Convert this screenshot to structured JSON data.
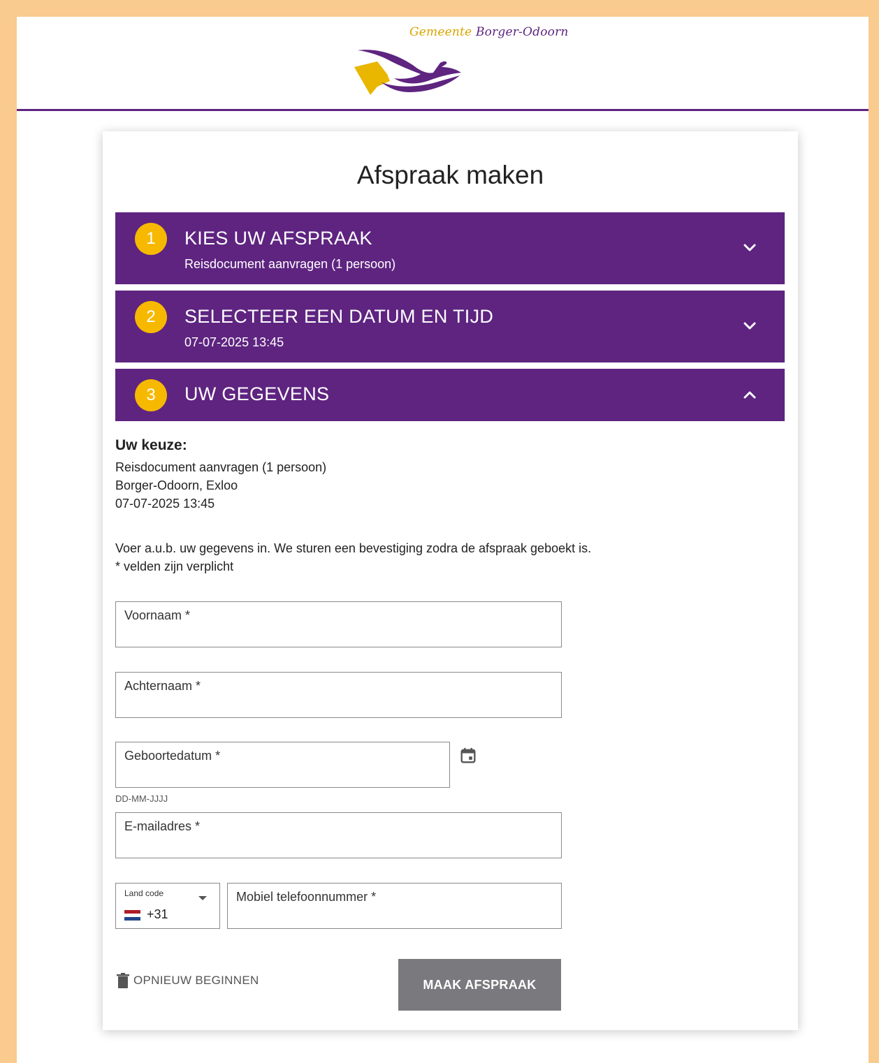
{
  "header": {
    "brand_word1": "Gemeente",
    "brand_word2": "Borger-Odoorn"
  },
  "page": {
    "title": "Afspraak maken"
  },
  "steps": [
    {
      "number": "1",
      "title": "KIES UW AFSPRAAK",
      "subtitle": "Reisdocument aanvragen (1 persoon)",
      "state": "collapsed",
      "icon": "chevron-down-icon"
    },
    {
      "number": "2",
      "title": "SELECTEER EEN DATUM EN TIJD",
      "subtitle": "07-07-2025 13:45",
      "state": "collapsed",
      "icon": "chevron-down-icon"
    },
    {
      "number": "3",
      "title": "UW GEGEVENS",
      "subtitle": "",
      "state": "expanded",
      "icon": "chevron-up-icon"
    }
  ],
  "choice": {
    "heading": "Uw keuze:",
    "lines": [
      "Reisdocument aanvragen (1 persoon)",
      "Borger-Odoorn, Exloo",
      "07-07-2025 13:45"
    ]
  },
  "instructions": {
    "line1": "Voer a.u.b. uw gegevens in. We sturen een bevestiging zodra de afspraak geboekt is.",
    "line2": "* velden zijn verplicht"
  },
  "form": {
    "first_name_label": "Voornaam *",
    "last_name_label": "Achternaam *",
    "birthdate_label": "Geboortedatum *",
    "birthdate_hint": "DD-MM-JJJJ",
    "email_label": "E-mailadres *",
    "country_code_label": "Land code",
    "country_code_value": "+31",
    "phone_label": "Mobiel telefoonnummer *"
  },
  "actions": {
    "reset_label": "OPNIEUW BEGINNEN",
    "submit_label": "MAAK AFSPRAAK"
  },
  "colors": {
    "purple": "#5e2480",
    "gold": "#f6b900",
    "frame": "#f9cb8f",
    "button_disabled": "#7a7a7e"
  }
}
